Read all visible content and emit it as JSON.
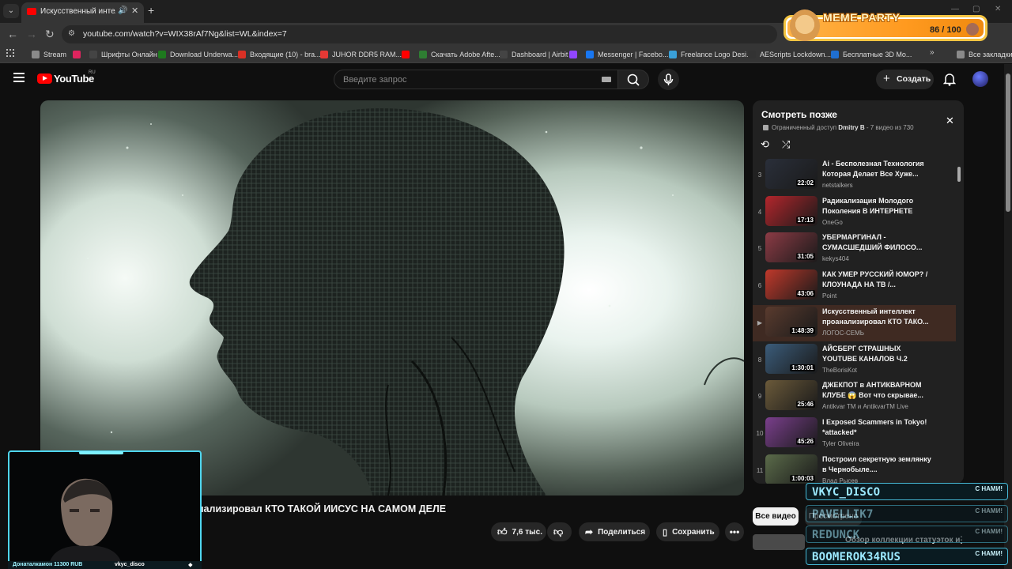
{
  "browser": {
    "tab_title": "Искусственный интеллект",
    "url": "youtube.com/watch?v=WIX38rAf7Ng&list=WL&index=7",
    "bookmarks": [
      {
        "label": "Stream",
        "color": "#8a8a8a"
      },
      {
        "label": "",
        "color": "#e0245e"
      },
      {
        "label": "Шрифты Онлайн",
        "color": "#444444"
      },
      {
        "label": "Download Underwa...",
        "color": "#1e7a1e"
      },
      {
        "label": "Входящие (10) - bra...",
        "color": "#d93025"
      },
      {
        "label": "JUHOR DDR5 RAM...",
        "color": "#e53935"
      },
      {
        "label": "",
        "color": "#ff0000"
      },
      {
        "label": "Скачать Adobe Afte...",
        "color": "#2e7d32"
      },
      {
        "label": "Dashboard | Airbit",
        "color": "#444444"
      },
      {
        "label": "",
        "color": "#9146ff"
      },
      {
        "label": "Messenger | Facebo...",
        "color": "#1877f2"
      },
      {
        "label": "Freelance Logo Desi...",
        "color": "#3aa0d8"
      },
      {
        "label": "AEScripts Lockdown...",
        "color": "#333333"
      },
      {
        "label": "Бесплатные 3D Mo...",
        "color": "#1f6fd1"
      },
      {
        "label": "Все закладки",
        "color": "#8a8a8a"
      }
    ]
  },
  "overlay_meme": {
    "title": "MEME PARTY",
    "count": "86 / 100"
  },
  "header": {
    "logo": "YouTube",
    "logo_region": "RU",
    "search_placeholder": "Введите запрос",
    "create_label": "Создать"
  },
  "video": {
    "title_visible": "нализировал КТО ТАКОЙ ИИСУС НА САМОМ ДЕЛЕ",
    "likes": "7,6 тыс.",
    "share_label": "Поделиться",
    "save_label": "Сохранить"
  },
  "playlist": {
    "title": "Смотреть позже",
    "access": "Ограниченный доступ",
    "owner": "Dmitry B",
    "meta": " - 7 видео из 730",
    "items": [
      {
        "index": "3",
        "title": "Ai - Бесполезная Технология Которая Делает Все Хуже...",
        "channel": "netstalkers",
        "duration": "22:02",
        "thumb": "#2a2f3a",
        "active": false
      },
      {
        "index": "4",
        "title": "Радикализация Молодого Поколения В ИНТЕРНЕТЕ",
        "channel": "OneGo",
        "duration": "17:13",
        "thumb": "#b3262c",
        "active": false
      },
      {
        "index": "5",
        "title": "УБЕРМАРГИНАЛ - СУМАСШЕДШИЙ ФИЛОСО...",
        "channel": "kekys404",
        "duration": "31:05",
        "thumb": "#8c3b45",
        "active": false
      },
      {
        "index": "6",
        "title": "КАК УМЕР РУССКИЙ ЮМОР? / КЛОУНАДА НА ТВ /...",
        "channel": "Point",
        "duration": "43:06",
        "thumb": "#c0392b",
        "active": false
      },
      {
        "index": "▶",
        "title": "Искусственный интеллект проанализировал КТО ТАКО...",
        "channel": "ЛОГОС-СЕМЬ",
        "duration": "1:48:39",
        "thumb": "#5a3b2e",
        "active": true
      },
      {
        "index": "8",
        "title": "АЙСБЕРГ СТРАШНЫХ YOUTUBE КАНАЛОВ Ч.2",
        "channel": "TheBorisKot",
        "duration": "1:30:01",
        "thumb": "#3b5c7a",
        "active": false
      },
      {
        "index": "9",
        "title": "ДЖЕКПОТ в АНТИКВАРНОМ КЛУБЕ 😱 Вот что скрывае...",
        "channel": "Antikvar TM и AntikvarTM Live",
        "duration": "25:46",
        "thumb": "#6b5a3a",
        "active": false
      },
      {
        "index": "10",
        "title": "I Exposed Scammers in Tokyo! *attacked*",
        "channel": "Tyler Oliveira",
        "duration": "45:26",
        "thumb": "#7a3f8c",
        "active": false
      },
      {
        "index": "11",
        "title": "Построил секретную землянку в Чернобыле....",
        "channel": "Влад Рысев",
        "duration": "1:00:03",
        "thumb": "#5b6b4a",
        "active": false
      }
    ]
  },
  "chips": {
    "all": "Все видео",
    "viewed": "Просмотрено"
  },
  "recommendation": {
    "title": "Обзор коллекции статуэток и"
  },
  "stream": {
    "donation": "Донаталкамон 11300 RUB",
    "nick": "vkyc_disco",
    "chat": [
      {
        "name": "VKYC_DISCO",
        "tag": "С НАМИ!"
      },
      {
        "name": "PAVELLIK7",
        "tag": "С НАМИ!"
      },
      {
        "name": "REDUNCK",
        "tag": "С НАМИ!"
      },
      {
        "name": "BOOMEROK34RUS",
        "tag": "С НАМИ!"
      }
    ]
  },
  "colors": {
    "brand": "#ff0000",
    "active_row": "#3f2a22",
    "chat_accent": "#46b9d6"
  }
}
